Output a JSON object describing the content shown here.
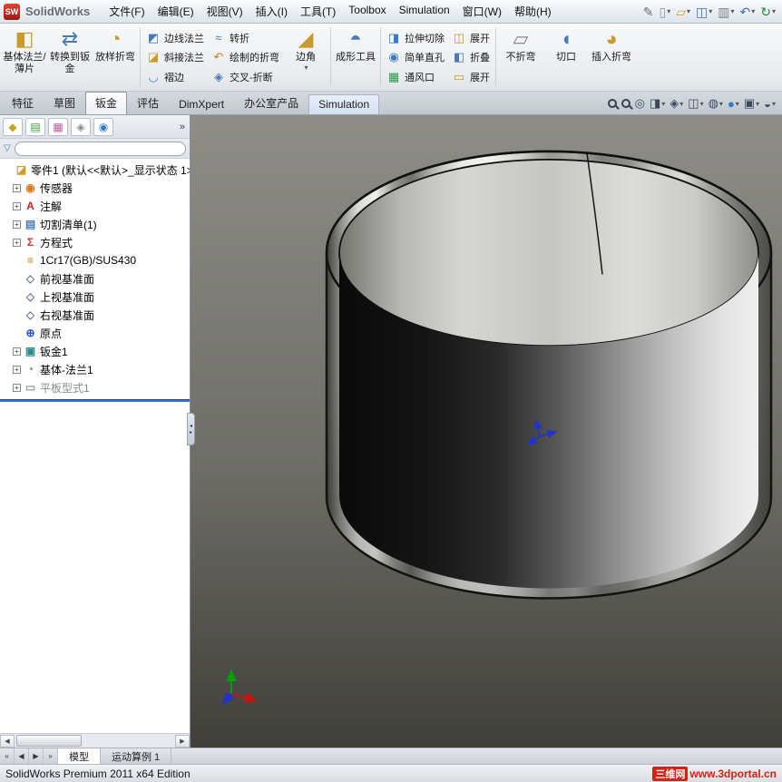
{
  "titlebar": {
    "app_name": "SolidWorks",
    "logo_text": "SW",
    "menus": [
      {
        "name": "file",
        "label": "文件(F)"
      },
      {
        "name": "edit",
        "label": "编辑(E)"
      },
      {
        "name": "view",
        "label": "视图(V)"
      },
      {
        "name": "insert",
        "label": "插入(I)"
      },
      {
        "name": "tools",
        "label": "工具(T)"
      },
      {
        "name": "toolbox",
        "label": "Toolbox"
      },
      {
        "name": "simulation",
        "label": "Simulation"
      },
      {
        "name": "window",
        "label": "窗口(W)"
      },
      {
        "name": "help",
        "label": "帮助(H)"
      }
    ],
    "toolbar_icons": [
      {
        "name": "pen",
        "glyph": "✎",
        "color": "#6a7078",
        "caret": false
      },
      {
        "name": "new-document",
        "glyph": "▯",
        "color": "#8a96a5",
        "caret": true
      },
      {
        "name": "open-folder",
        "glyph": "▱",
        "color": "#d8a62a",
        "caret": true
      },
      {
        "name": "save",
        "glyph": "◫",
        "color": "#3d6fb5",
        "caret": true
      },
      {
        "name": "print",
        "glyph": "▥",
        "color": "#7a8088",
        "caret": true
      },
      {
        "name": "undo",
        "glyph": "↶",
        "color": "#3d6fb5",
        "caret": true
      },
      {
        "name": "rebuild",
        "glyph": "↻",
        "color": "#2a8a3a",
        "caret": true
      }
    ]
  },
  "ribbon": {
    "items": [
      {
        "type": "large",
        "name": "base-flange",
        "label": "基体法兰/薄片",
        "glyph": "◧",
        "color": "#c99a2e"
      },
      {
        "type": "large",
        "name": "convert-to-sheet-metal",
        "label": "转换到钣金",
        "glyph": "⇄",
        "color": "#4a7ab5"
      },
      {
        "type": "large",
        "name": "lofted-bend",
        "label": "放样折弯",
        "glyph": "◔",
        "color": "#c99a2e"
      },
      {
        "type": "sep"
      },
      {
        "type": "stack",
        "buttons": [
          {
            "name": "edge-flange",
            "label": "边线法兰",
            "glyph": "◩",
            "color": "#4a7ab5"
          },
          {
            "name": "miter-flange",
            "label": "斜接法兰",
            "glyph": "◪",
            "color": "#c99a2e"
          },
          {
            "name": "hem",
            "label": "褶边",
            "glyph": "◡",
            "color": "#4a7ab5"
          }
        ]
      },
      {
        "type": "stack",
        "buttons": [
          {
            "name": "jog",
            "label": "转折",
            "glyph": "≈",
            "color": "#4a7ab5"
          },
          {
            "name": "sketched-bend",
            "label": "绘制的折弯",
            "glyph": "↶",
            "color": "#cc7722"
          },
          {
            "name": "cross-break",
            "label": "交叉-折断",
            "glyph": "◈",
            "color": "#4a7ab5"
          }
        ]
      },
      {
        "type": "large",
        "name": "corners",
        "label": "边角",
        "glyph": "◢",
        "color": "#c99a2e",
        "dropdown": true
      },
      {
        "type": "sep"
      },
      {
        "type": "large",
        "name": "forming-tool",
        "label": "成形工具",
        "glyph": "◓",
        "color": "#4a7ab5"
      },
      {
        "type": "sep"
      },
      {
        "type": "stack",
        "buttons": [
          {
            "name": "extruded-cut",
            "label": "拉伸切除",
            "glyph": "◨",
            "color": "#3a78c8"
          },
          {
            "name": "simple-hole",
            "label": "简单直孔",
            "glyph": "◉",
            "color": "#3a78c8"
          },
          {
            "name": "vent",
            "label": "通风口",
            "glyph": "▦",
            "color": "#2a9a4a"
          }
        ]
      },
      {
        "type": "stack",
        "buttons": [
          {
            "name": "unfold",
            "label": "展开",
            "glyph": "◫",
            "color": "#c99a2e"
          },
          {
            "name": "fold",
            "label": "折叠",
            "glyph": "◧",
            "color": "#4a7ab5"
          },
          {
            "name": "flatten",
            "label": "展开",
            "glyph": "▭",
            "color": "#c99a2e"
          }
        ]
      },
      {
        "type": "sep"
      },
      {
        "type": "large",
        "name": "no-bends",
        "label": "不折弯",
        "glyph": "▱",
        "color": "#88888f"
      },
      {
        "type": "large",
        "name": "rip",
        "label": "切口",
        "glyph": "◖",
        "color": "#4a7ab5"
      },
      {
        "type": "large",
        "name": "insert-bends",
        "label": "插入折弯",
        "glyph": "◕",
        "color": "#c99a2e"
      }
    ]
  },
  "command_tabs": {
    "tabs": [
      {
        "name": "features",
        "label": "特征",
        "state": "normal"
      },
      {
        "name": "sketch",
        "label": "草图",
        "state": "normal"
      },
      {
        "name": "sheet-metal",
        "label": "钣金",
        "state": "active"
      },
      {
        "name": "evaluate",
        "label": "评估",
        "state": "normal"
      },
      {
        "name": "dimxpert",
        "label": "DimXpert",
        "state": "normal"
      },
      {
        "name": "office-products",
        "label": "办公室产品",
        "state": "normal"
      },
      {
        "name": "simulation",
        "label": "Simulation",
        "state": "sim"
      }
    ]
  },
  "view_toolbar": {
    "icons": [
      {
        "name": "zoom-fit",
        "kind": "mag",
        "caret": false
      },
      {
        "name": "zoom-area",
        "kind": "mag",
        "caret": false
      },
      {
        "name": "zoom-previous",
        "kind": "glyph",
        "glyph": "◎",
        "color": "#3a4a5a",
        "caret": false
      },
      {
        "name": "section-view",
        "kind": "glyph",
        "glyph": "◨",
        "color": "#3a4a5a",
        "caret": true
      },
      {
        "name": "view-orientation",
        "kind": "glyph",
        "glyph": "◈",
        "color": "#3a4a5a",
        "caret": true
      },
      {
        "name": "display-style",
        "kind": "glyph",
        "glyph": "◫",
        "color": "#3a4a5a",
        "caret": true
      },
      {
        "name": "hide-show-items",
        "kind": "glyph",
        "glyph": "◍",
        "color": "#3a4a5a",
        "caret": true
      },
      {
        "name": "edit-appearance",
        "kind": "glyph",
        "glyph": "●",
        "color": "#2a7ad0",
        "caret": true
      },
      {
        "name": "apply-scene",
        "kind": "glyph",
        "glyph": "▣",
        "color": "#3a4a5a",
        "caret": true
      },
      {
        "name": "view-settings",
        "kind": "glyph",
        "glyph": "◒",
        "color": "#3a4a5a",
        "caret": true
      }
    ]
  },
  "feature_tree": {
    "panel_tabs": [
      {
        "name": "featuremanager",
        "glyph": "◆",
        "color": "#c9a227"
      },
      {
        "name": "propertymanager",
        "glyph": "▤",
        "color": "#3a9a3a"
      },
      {
        "name": "configurationmanager",
        "glyph": "▦",
        "color": "#c05aa0"
      },
      {
        "name": "dimxpertmanager",
        "glyph": "◈",
        "color": "#82888f"
      },
      {
        "name": "displaymanager",
        "glyph": "◉",
        "color": "#3a78c8"
      }
    ],
    "chevron": "»",
    "filter_value": "",
    "items": [
      {
        "name": "part-root",
        "label": "零件1 (默认<<默认>_显示状态 1>",
        "icon": "part",
        "glyph": "◪",
        "color": "#c9a227",
        "expand": false,
        "root": true
      },
      {
        "name": "sensors",
        "label": "传感器",
        "icon": "sensors",
        "glyph": "◉",
        "color": "#d97a1a",
        "expand": true
      },
      {
        "name": "annotations",
        "label": "注解",
        "icon": "annotations",
        "glyph": "A",
        "color": "#cc2222",
        "expand": true
      },
      {
        "name": "cut-list",
        "label": "切割清单(1)",
        "icon": "cut-list",
        "glyph": "▤",
        "color": "#4a7ab5",
        "expand": true
      },
      {
        "name": "equations",
        "label": "方程式",
        "icon": "equations",
        "glyph": "Σ",
        "color": "#cc3333",
        "expand": true
      },
      {
        "name": "material",
        "label": "1Cr17(GB)/SUS430",
        "icon": "material",
        "glyph": "≡",
        "color": "#b8860b",
        "expand": false
      },
      {
        "name": "front-plane",
        "label": "前视基准面",
        "icon": "plane",
        "glyph": "◇",
        "color": "#6f7f94",
        "expand": false
      },
      {
        "name": "top-plane",
        "label": "上视基准面",
        "icon": "plane",
        "glyph": "◇",
        "color": "#6f7f94",
        "expand": false
      },
      {
        "name": "right-plane",
        "label": "右视基准面",
        "icon": "plane",
        "glyph": "◇",
        "color": "#6f7f94",
        "expand": false
      },
      {
        "name": "origin",
        "label": "原点",
        "icon": "origin",
        "glyph": "⊕",
        "color": "#3355cc",
        "expand": false
      },
      {
        "name": "sheet-metal-1",
        "label": "钣金1",
        "icon": "sheet-metal",
        "glyph": "▣",
        "color": "#2a8a8a",
        "expand": true
      },
      {
        "name": "base-flange-1",
        "label": "基体-法兰1",
        "icon": "base-flange-feature",
        "glyph": "◔",
        "color": "#4a7ab5",
        "expand": true
      },
      {
        "name": "flat-pattern-1",
        "label": "平板型式1",
        "icon": "flat-pattern",
        "glyph": "▭",
        "color": "#9a9a9a",
        "expand": true,
        "suppressed": true
      }
    ]
  },
  "bottom_bar": {
    "nav": [
      "«",
      "◀",
      "▶",
      "»"
    ],
    "tabs": [
      {
        "name": "model",
        "label": "模型",
        "active": true
      },
      {
        "name": "motion-study-1",
        "label": "运动算例 1",
        "active": false
      }
    ]
  },
  "statusbar": {
    "text": "SolidWorks Premium 2011 x64 Edition",
    "watermark_badge": "三维网",
    "watermark_url": "www.3dportal.cn"
  }
}
